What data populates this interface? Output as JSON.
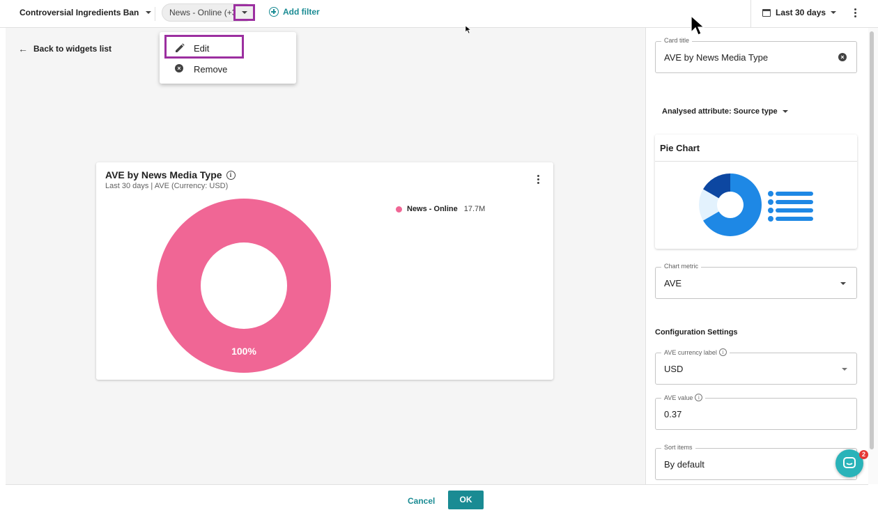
{
  "topbar": {
    "project": "Controversial Ingredients Ban",
    "filter_chip": "News - Online (+3",
    "add_filter": "Add filter",
    "date_range": "Last 30 days"
  },
  "menu": {
    "edit": "Edit",
    "remove": "Remove"
  },
  "main": {
    "back": "Back to widgets list"
  },
  "card": {
    "title": "AVE by News Media Type",
    "subtitle": "Last 30 days | AVE (Currency: USD)"
  },
  "chart_data": {
    "type": "pie",
    "categories": [
      "News - Online"
    ],
    "values": [
      100
    ],
    "legend_values": [
      "17.7M"
    ],
    "slice_labels": [
      "100%"
    ],
    "colors": [
      "#f06695"
    ],
    "donut": true,
    "legend_position": "top-right"
  },
  "panel": {
    "card_title_label": "Card title",
    "card_title_value": "AVE by News Media Type",
    "analysed_attribute": "Analysed attribute: Source type",
    "pie_chart_label": "Pie Chart",
    "chart_metric_label": "Chart metric",
    "chart_metric_value": "AVE",
    "config_heading": "Configuration Settings",
    "ave_currency_label": "AVE currency label",
    "ave_currency_value": "USD",
    "ave_value_label": "AVE value",
    "ave_value_value": "0.37",
    "sort_items_label": "Sort items",
    "sort_items_value": "By default"
  },
  "footer": {
    "cancel": "Cancel",
    "ok": "OK"
  },
  "chat": {
    "badge": "2"
  },
  "colors": {
    "accent": "#1a8b93",
    "highlight": "#9c2fa0",
    "slice": "#f06695"
  }
}
